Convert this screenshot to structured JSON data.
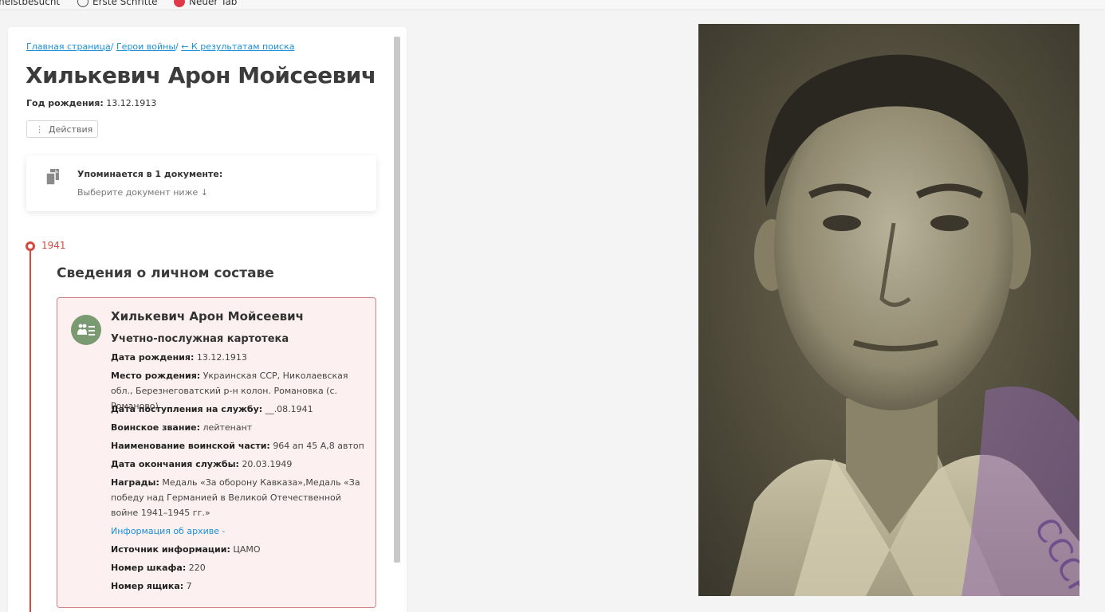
{
  "bookmarks": [
    {
      "label": "meistbesucht"
    },
    {
      "label": "Erste Schritte"
    },
    {
      "label": "Neuer Tab"
    }
  ],
  "breadcrumb": {
    "home": "Главная страница",
    "sep1": "/ ",
    "heroes": "Герои войны",
    "sep2": "/ ",
    "back": "← К результатам поиска"
  },
  "person": {
    "name": "Хилькевич Арон Мойсеевич",
    "birth_label": "Год рождения:",
    "birth_value": "13.12.1913"
  },
  "actions_label": "Действия",
  "mention": {
    "title": "Упоминается в 1 документе:",
    "subtitle": "Выберите документ ниже ↓"
  },
  "timeline": {
    "year": "1941",
    "section_title": "Сведения о личном составе"
  },
  "record": {
    "name": "Хилькевич Арон Мойсеевич",
    "type": "Учетно-послужная картотека",
    "fields": [
      {
        "label": "Дата рождения:",
        "value": "13.12.1913"
      },
      {
        "label": "Место рождения:",
        "value": "Украинская ССР, Николаевская обл., Березнеговатский р-н колон. Романовка (с. Романово)"
      },
      {
        "label": "Дата поступления на службу:",
        "value": "__.08.1941"
      },
      {
        "label": "Воинское звание:",
        "value": "лейтенант"
      },
      {
        "label": "Наименование воинской части:",
        "value": "964 ап 45 А,8 автоп"
      },
      {
        "label": "Дата окончания службы:",
        "value": "20.03.1949"
      },
      {
        "label": "Награды:",
        "value": "Медаль «За оборону Кавказа»,Медаль «За победу над Германией в Великой Отечественной войне 1941–1945 гг.»"
      }
    ],
    "archive_link": "Информация об архиве -",
    "archive_fields": [
      {
        "label": "Источник информации:",
        "value": "ЦАМО"
      },
      {
        "label": "Номер шкафа:",
        "value": "220"
      },
      {
        "label": "Номер ящика:",
        "value": "7"
      }
    ]
  },
  "colors": {
    "accent_red": "#d24a3f",
    "link_blue": "#1a8fd8",
    "card_bg": "#fdf0f0",
    "icon_green": "#7a9a72"
  }
}
